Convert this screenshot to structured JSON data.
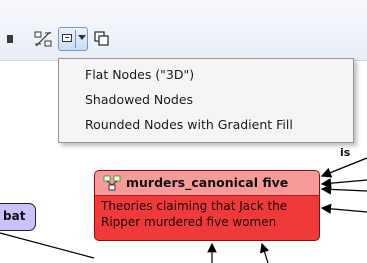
{
  "toolbar": {
    "icons": [
      "grid-layout-icon",
      "node-style-icon",
      "chevron-down-icon",
      "copy-nodes-icon"
    ]
  },
  "node_style_menu": {
    "items": [
      {
        "label": "Flat Nodes (\"3D\")"
      },
      {
        "label": "Shadowed Nodes"
      },
      {
        "label": "Rounded Nodes with Gradient Fill"
      }
    ]
  },
  "graph": {
    "main_node": {
      "title": "murders_canonical five",
      "body": "Theories claiming that Jack the Ripper murdered five women",
      "icon": "nodes-icon"
    },
    "left_node": {
      "label": "bat"
    },
    "edge_label": "is"
  },
  "colors": {
    "node_fill": "#f03a3a",
    "node_header": "#f79a9a",
    "left_node_fill": "#c9c2ff",
    "menu_bg": "#f5f5f5"
  }
}
